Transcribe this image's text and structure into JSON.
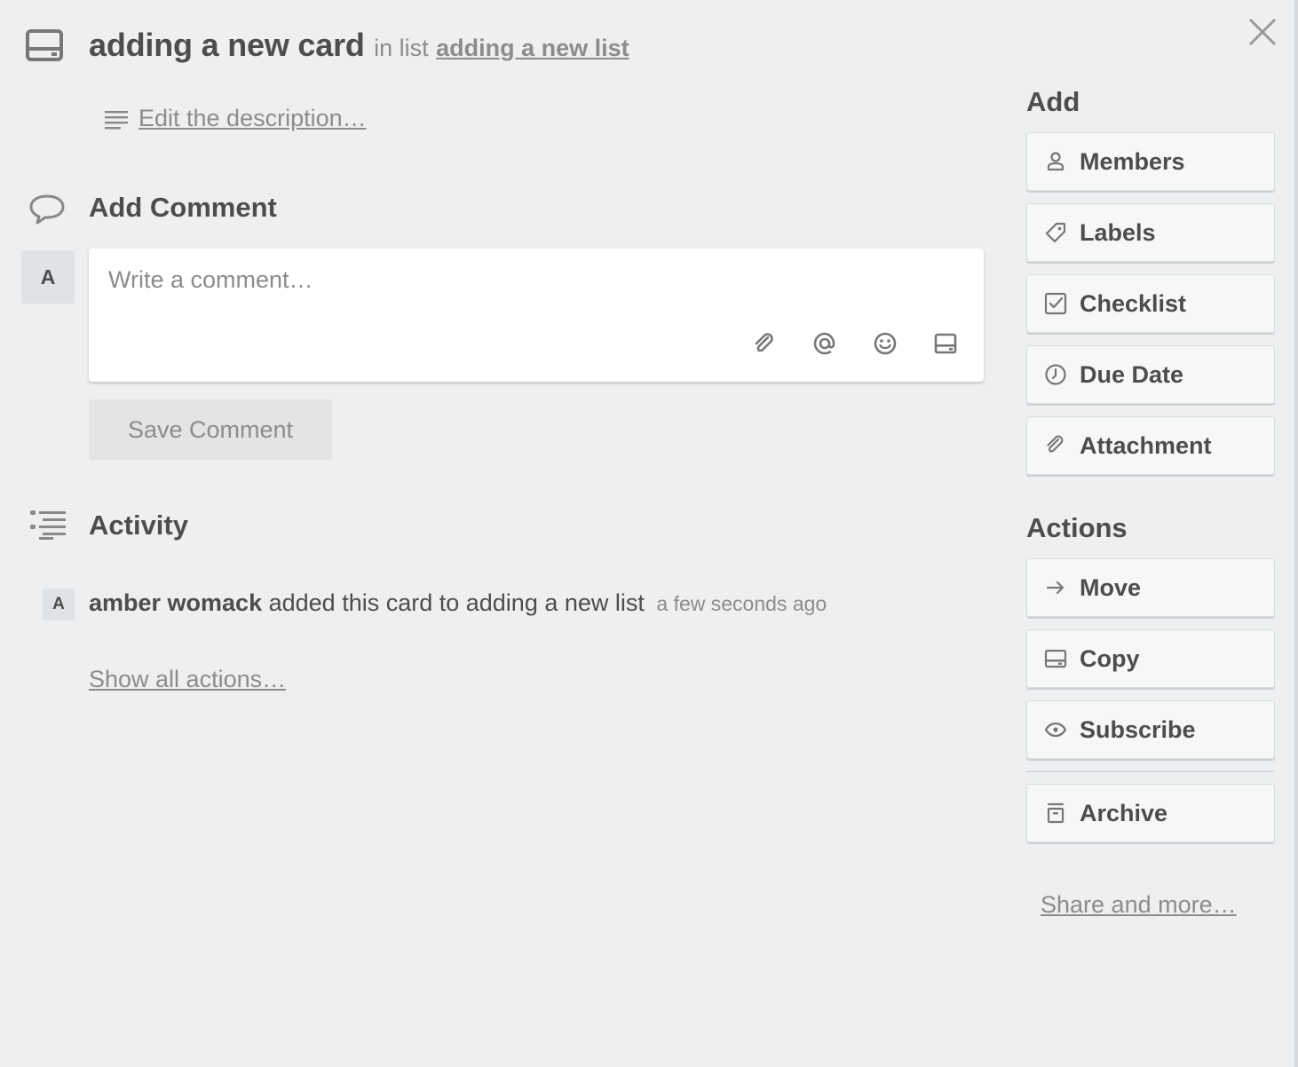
{
  "card": {
    "title": "adding a new card",
    "in_list_prefix": "in list",
    "list_name": "adding a new list",
    "description_link": "Edit the description…"
  },
  "comment": {
    "heading": "Add Comment",
    "avatar_initial": "A",
    "placeholder": "Write a comment…",
    "save_label": "Save Comment"
  },
  "activity": {
    "heading": "Activity",
    "entries": [
      {
        "avatar_initial": "A",
        "user": "amber womack",
        "action": "added this card to adding a new list",
        "time": "a few seconds ago"
      }
    ],
    "show_all": "Show all actions…"
  },
  "sidebar": {
    "add_heading": "Add",
    "add_items": [
      {
        "label": "Members",
        "icon": "person-icon"
      },
      {
        "label": "Labels",
        "icon": "tag-icon"
      },
      {
        "label": "Checklist",
        "icon": "checkbox-icon"
      },
      {
        "label": "Due Date",
        "icon": "clock-icon"
      },
      {
        "label": "Attachment",
        "icon": "paperclip-icon"
      }
    ],
    "actions_heading": "Actions",
    "action_items": [
      {
        "label": "Move",
        "icon": "arrow-right-icon"
      },
      {
        "label": "Copy",
        "icon": "card-icon"
      },
      {
        "label": "Subscribe",
        "icon": "eye-icon"
      },
      {
        "label": "Archive",
        "icon": "archive-icon"
      }
    ],
    "share_link": "Share and more…"
  },
  "colors": {
    "background": "#edeff0",
    "text": "#4d4d4d",
    "muted": "#8c8c8c",
    "button": "#f6f7f7"
  }
}
